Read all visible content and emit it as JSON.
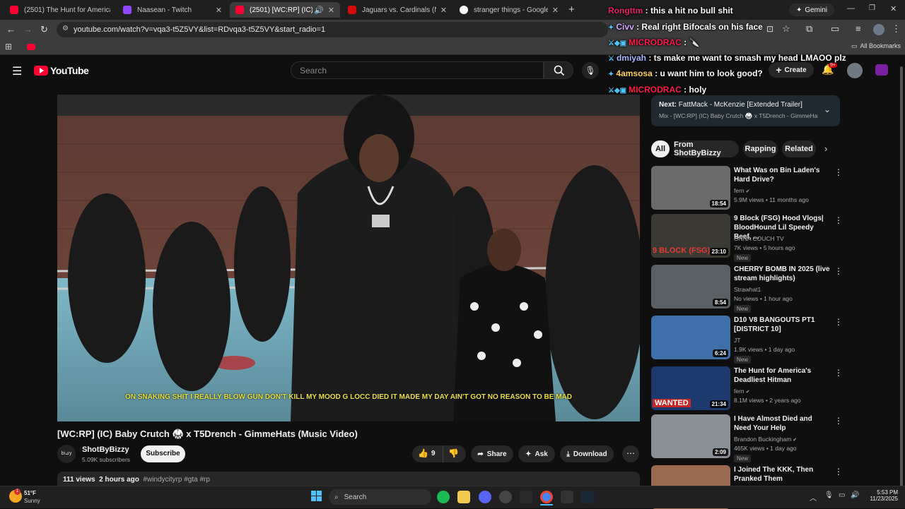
{
  "browser": {
    "tabs": [
      {
        "title": "(2501) The Hunt for America's ",
        "fav": "#ff0033"
      },
      {
        "title": "Naasean - Twitch",
        "fav": "#9146ff"
      },
      {
        "title": "(2501) [WC:RP] (IC) Baby Cr",
        "fav": "#ff0033"
      },
      {
        "title": "Jaguars vs. Cardinals (Nov 23, 2",
        "fav": "#d50a0a"
      },
      {
        "title": "stranger things - Google Search",
        "fav": "#ffffff"
      }
    ],
    "url": "youtube.com/watch?v=vqa3-t5Z5VY&list=RDvqa3-t5Z5VY&start_radio=1",
    "gemini_label": "Gemini",
    "all_bookmarks": "All Bookmarks"
  },
  "youtube": {
    "logo_text": "YouTube",
    "search_placeholder": "Search",
    "create_label": "Create",
    "notif_count": "9+",
    "video": {
      "subtitle": "ON SNAKING SHIT  I REALLY BLOW GUN DON'T KILL MY MOOD  G LOCC DIED  IT MADE MY DAY  AIN'T GOT NO REASON TO BE MAD",
      "title": "[WC:RP] (IC) Baby Crutch 🥋 x T5Drench - GimmeHats (Music Video)",
      "channel": "ShotByBizzy",
      "subscribers": "5.09K subscribers",
      "subscribe_label": "Subscribe",
      "likes": "9",
      "share_label": "Share",
      "ask_label": "Ask",
      "download_label": "Download",
      "views": "111 views",
      "age": "2 hours ago",
      "tags": "#windycityrp #gta #rp"
    },
    "next": {
      "label": "Next:",
      "title": "FattMack - McKenzie [Extended Trailer]",
      "mix": "Mix - [WC:RP] (IC) Baby Crutch 🥋 x T5Drench - GimmeHats (..."
    },
    "chips": [
      "All",
      "From ShotByBizzy",
      "Rapping",
      "Related"
    ],
    "related": [
      {
        "title": "What Was on Bin Laden's Hard Drive?",
        "channel": "fern",
        "verified": true,
        "meta": "5.9M views • 11 months ago",
        "duration": "18:54",
        "is_new": false,
        "thumb": "#6b6b6b"
      },
      {
        "title": "9 Block (FSG) Hood Vlogs| BloodHound Lil Speedy Beef, ...",
        "channel": "ONNA COUCH TV",
        "verified": false,
        "meta": "7K views • 5 hours ago",
        "duration": "23:10",
        "is_new": true,
        "thumb_text": "9 BLOCK (FSG)",
        "thumb": "#3a3a32"
      },
      {
        "title": "CHERRY BOMB IN 2025 (live stream highlights)",
        "channel": "Strawhat1",
        "verified": false,
        "meta": "No views • 1 hour ago",
        "duration": "8:54",
        "is_new": true,
        "thumb": "#5a5f64"
      },
      {
        "title": "D10 V8 BANGOUTS PT1 [DISTRICT 10]",
        "channel": "JT",
        "verified": false,
        "meta": "1.9K views • 1 day ago",
        "duration": "6:24",
        "is_new": true,
        "thumb": "#3f6fa8"
      },
      {
        "title": "The Hunt for America's Deadliest Hitman",
        "channel": "fern",
        "verified": true,
        "meta": "8.1M views • 2 years ago",
        "duration": "21:34",
        "is_new": false,
        "thumb_text": "WANTED",
        "thumb": "#1d3a6e"
      },
      {
        "title": "I Have Almost Died and Need Your Help",
        "channel": "Brandon Buckingham",
        "verified": true,
        "meta": "465K views • 1 day ago",
        "duration": "2:09",
        "is_new": true,
        "thumb": "#8a8f95"
      },
      {
        "title": "I Joined The KKK, Then Pranked Them",
        "channel": "",
        "verified": false,
        "meta": "",
        "duration": "",
        "is_new": false,
        "thumb": "#9a6a50"
      }
    ]
  },
  "chat_overlay": [
    {
      "user": "Rongttm",
      "user_color": "#e91e63",
      "msg": "this a hit no bull shit",
      "badges": ""
    },
    {
      "user": "Civv",
      "user_color": "#d4a8ff",
      "msg": "Real right Bifocals on his face",
      "badges": "✦"
    },
    {
      "user": "MICRODRAC",
      "user_color": "#ff1a4a",
      "msg": "🔪",
      "badges": "⚔◆▣"
    },
    {
      "user": "dmiyah",
      "user_color": "#a9b7ff",
      "msg": "ts make me want to smash my head LMAOO plz",
      "badges": "⚔"
    },
    {
      "user": "4amsosa",
      "user_color": "#ffd54a",
      "msg": "u want him to look good?",
      "badges": "✦"
    },
    {
      "user": "MICRODRAC",
      "user_color": "#ff1a4a",
      "msg": "holy",
      "badges": "⚔◆▣"
    }
  ],
  "taskbar": {
    "weather_temp": "51°F",
    "weather_desc": "Sunny",
    "weather_badge": "1",
    "search_label": "Search",
    "time": "5:53 PM",
    "date": "11/23/2025"
  }
}
